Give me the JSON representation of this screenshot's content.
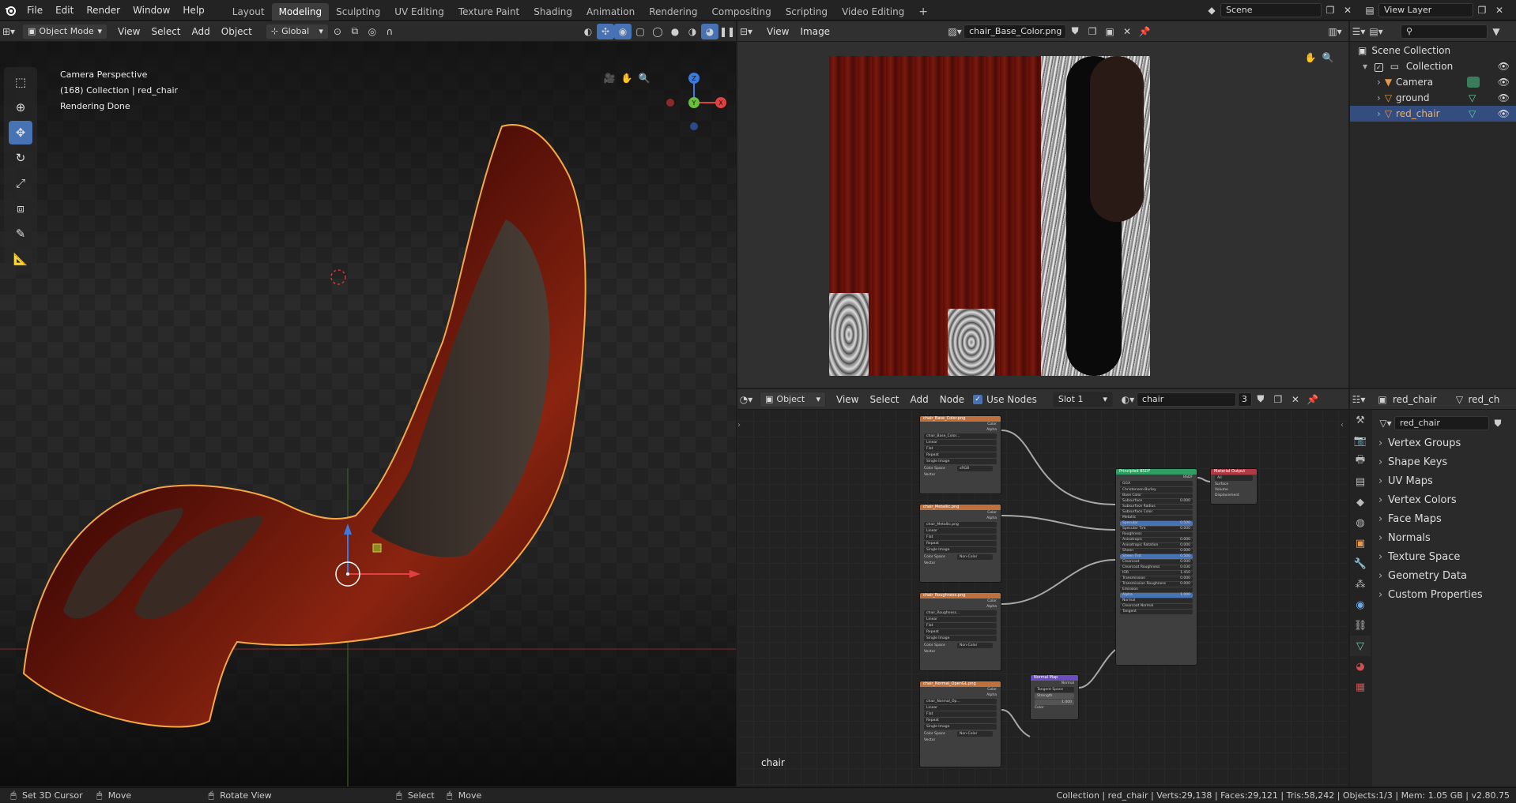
{
  "topbar": {
    "menus": [
      "File",
      "Edit",
      "Render",
      "Window",
      "Help"
    ],
    "workspaces": [
      "Layout",
      "Modeling",
      "Sculpting",
      "UV Editing",
      "Texture Paint",
      "Shading",
      "Animation",
      "Rendering",
      "Compositing",
      "Scripting",
      "Video Editing"
    ],
    "active_workspace": "Modeling",
    "add_tab": "+",
    "scene": "Scene",
    "view_layer": "View Layer"
  },
  "viewport": {
    "mode": "Object Mode",
    "menus": [
      "View",
      "Select",
      "Add",
      "Object"
    ],
    "orientation": "Global",
    "overlay_lines": [
      "Camera Perspective",
      "(168) Collection | red_chair",
      "Rendering Done"
    ],
    "gizmo": {
      "z": "Z",
      "y": "Y",
      "x": "X"
    }
  },
  "image_editor": {
    "menus": [
      "View",
      "Image"
    ],
    "image_name": "chair_Base_Color.png"
  },
  "node_editor": {
    "object_label": "Object",
    "menus": [
      "View",
      "Select",
      "Add",
      "Node"
    ],
    "use_nodes_label": "Use Nodes",
    "use_nodes_checked": true,
    "slot": "Slot 1",
    "material": "chair",
    "users": "3",
    "footer_label": "chair",
    "texture_nodes": [
      {
        "title": "chair_Base_Color.png",
        "img": "chair_Base_Color...",
        "colorspace": "sRGB",
        "color": "#c0703a"
      },
      {
        "title": "chair_Metallic.png",
        "img": "chair_Metallic.png",
        "colorspace": "Non-Color",
        "color": "#c0703a"
      },
      {
        "title": "chair_Roughness.png",
        "img": "chair_Roughness...",
        "colorspace": "Non-Color",
        "color": "#c0703a"
      },
      {
        "title": "chair_Normal_OpenGL.png",
        "img": "chair_Normal_Op...",
        "colorspace": "Non-Color",
        "color": "#c0703a"
      }
    ],
    "texture_fields": [
      "Linear",
      "Flat",
      "Repeat",
      "Single Image"
    ],
    "texture_outputs": [
      "Color",
      "Alpha"
    ],
    "texture_cs_label": "Color Space",
    "texture_vector": "Vector",
    "bsdf": {
      "title": "Principled BSDF",
      "out": "BSDF",
      "dist": "GGX",
      "sss": "Christensen-Burley",
      "rows": [
        [
          "Base Color",
          ""
        ],
        [
          "Subsurface",
          "0.000"
        ],
        [
          "Subsurface Radius",
          ""
        ],
        [
          "Subsurface Color",
          ""
        ],
        [
          "Metallic",
          ""
        ],
        [
          "Specular",
          "0.500"
        ],
        [
          "Specular Tint",
          "0.000"
        ],
        [
          "Roughness",
          ""
        ],
        [
          "Anisotropic",
          "0.000"
        ],
        [
          "Anisotropic Rotation",
          "0.000"
        ],
        [
          "Sheen",
          "0.000"
        ],
        [
          "Sheen Tint",
          "0.500"
        ],
        [
          "Clearcoat",
          "0.000"
        ],
        [
          "Clearcoat Roughness",
          "0.030"
        ],
        [
          "IOR",
          "1.450"
        ],
        [
          "Transmission",
          "0.000"
        ],
        [
          "Transmission Roughness",
          "0.000"
        ],
        [
          "Emission",
          ""
        ],
        [
          "Alpha",
          "1.000"
        ],
        [
          "Normal",
          ""
        ],
        [
          "Clearcoat Normal",
          ""
        ],
        [
          "Tangent",
          ""
        ]
      ]
    },
    "output_node": {
      "title": "Material Output",
      "target": "All",
      "sockets": [
        "Surface",
        "Volume",
        "Displacement"
      ]
    },
    "normal_node": {
      "title": "Normal Map",
      "out": "Normal",
      "space": "Tangent Space",
      "strength_label": "Strength",
      "strength": "1.000",
      "in": "Color"
    }
  },
  "outliner": {
    "root": "Scene Collection",
    "collection": "Collection",
    "items": [
      {
        "name": "Camera",
        "selected": false
      },
      {
        "name": "ground",
        "selected": false
      },
      {
        "name": "red_chair",
        "selected": true
      }
    ]
  },
  "properties": {
    "object_name": "red_chair",
    "data_tab": "red_ch",
    "mesh_name": "red_chair",
    "panels": [
      "Vertex Groups",
      "Shape Keys",
      "UV Maps",
      "Vertex Colors",
      "Face Maps",
      "Normals",
      "Texture Space",
      "Geometry Data",
      "Custom Properties"
    ]
  },
  "statusbar": {
    "left": [
      {
        "key": "Set 3D Cursor",
        "action": "Move"
      },
      {
        "key": "Rotate View",
        "action": ""
      },
      {
        "key": "Select",
        "action": "Move"
      }
    ],
    "right": "Collection | red_chair | Verts:29,138 | Faces:29,121 | Tris:58,242 | Objects:1/3 | Mem: 1.05 GB | v2.80.75"
  },
  "colors": {
    "accent": "#4772b3",
    "selection": "#f5a742",
    "bsdf_header": "#2f9e63",
    "output_header": "#b03a44",
    "normal_header": "#6c4fbf",
    "texture_header": "#c0703a"
  }
}
